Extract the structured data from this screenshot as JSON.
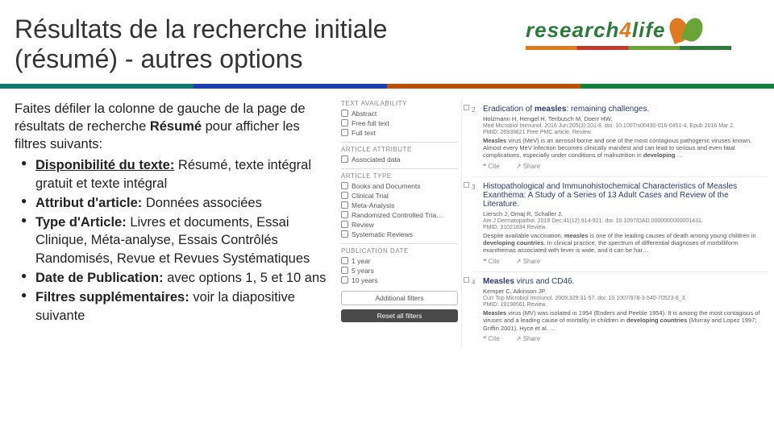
{
  "title_l1": "Résultats de la recherche initiale",
  "title_l2": "(résumé) - autres options",
  "logo": {
    "research": "research",
    "four": "4",
    "life": "life"
  },
  "intro_a": "Faites défiler la colonne de gauche de la page de résultats de recherche ",
  "intro_b": "Résumé",
  "intro_c": " pour afficher les filtres suivants:",
  "bullets": [
    {
      "head": "Disponibilité du texte:",
      "tail": " Résumé, texte intégral gratuit et texte intégral",
      "underline_head": true
    },
    {
      "head": "Attribut d'article:",
      "tail": " Données associées"
    },
    {
      "head": "Type d'Article:",
      "tail": " Livres et documents, Essai Clinique, Méta-analyse, Essais Contrôlés Randomisés, Revue et Revues Systématiques"
    },
    {
      "head": "Date de Publication:",
      "tail": " avec options 1, 5 et 10 ans"
    },
    {
      "head": "Filtres supplémentaires:",
      "tail": " voir la diapositive suivante"
    }
  ],
  "filters": {
    "g1": {
      "title": "TEXT AVAILABILITY",
      "items": [
        "Abstract",
        "Free full text",
        "Full text"
      ]
    },
    "g2": {
      "title": "ARTICLE ATTRIBUTE",
      "items": [
        "Associated data"
      ]
    },
    "g3": {
      "title": "ARTICLE TYPE",
      "items": [
        "Books and Documents",
        "Clinical Trial",
        "Meta-Analysis",
        "Randomized Controlled Tria...",
        "Review",
        "Systematic Reviews"
      ]
    },
    "g4": {
      "title": "PUBLICATION DATE",
      "items": [
        "1 year",
        "5 years",
        "10 years"
      ]
    },
    "additional": "Additional filters",
    "reset": "Reset all filters"
  },
  "results": [
    {
      "n": "2",
      "title_a": "Eradication of ",
      "title_hl": "measles",
      "title_b": ": remaining challenges.",
      "auth": "Holzmann H, Hengel H, Tenbusch M, Doerr HW.",
      "meta1": "Med Microbiol Immunol. 2016 Jun;205(3):201-8. doi: 10.1007/s00430-016-0451-4. Epub 2016 Mar 2.",
      "meta2": "PMID: 26939821    Free PMC article.    Review.",
      "desc_a": "Measles",
      "desc_b": " virus (MeV) is an aerosol-borne and one of the most contagious pathogenic viruses known. Almost every MeV infection becomes clinically manifest and can lead to serious and even fatal complications, especially under conditions of malnutrition in ",
      "desc_c": "developing",
      "desc_d": " …"
    },
    {
      "n": "3",
      "title_a": "Histopathological and Immunohistochemical Characteristics of Measles Exanthema: A Study of a Series of 13 Adult Cases and Review of the Literature.",
      "auth": "Liersch J, Omaj R, Schaller J.",
      "meta1": "Am J Dermatopathol. 2019 Dec;41(12):914-921. doi: 10.1097/DAD.0000000000001431.",
      "meta2": "PMID: 31021834    Review.",
      "desc_a": "Despite available vaccination, ",
      "desc_b": "measles",
      "desc_c": " is one of the leading causes of death among young children in ",
      "desc_d": "developing countries",
      "desc_e": ". In clinical practice, the spectrum of differential diagnoses of morbilliform exanthemas associated with fever is wide, and it can be har…"
    },
    {
      "n": "4",
      "title_a": "Measles",
      "title_b": " virus and CD46.",
      "auth": "Kemper C, Atkinson JP.",
      "meta1": "Curr Top Microbiol Immunol. 2009;329:31-57. doi: 10.1007/978-3-540-70523-9_3.",
      "meta2": "PMID: 19198561    Review.",
      "desc_a": "Measles",
      "desc_b": " virus (MV) was isolated in 1954 (Enders and Peeble 1954). It is among the most contagious of viruses and a leading cause of mortality in children in ",
      "desc_c": "developing countries",
      "desc_d": " (Murray and Lopez 1997; Griffin 2001). Hyce et al. …"
    }
  ],
  "actions": {
    "cite": "Cite",
    "share": "Share"
  }
}
